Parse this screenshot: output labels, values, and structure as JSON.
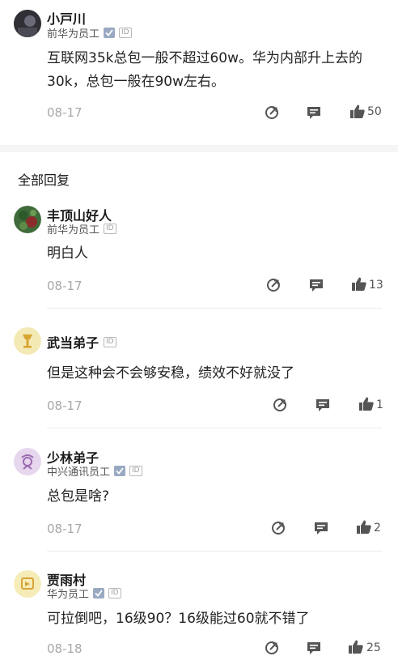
{
  "post": {
    "author": "小戸川",
    "company": "前华为员工",
    "content_line1": "互联网35k总包一般不超过60w。华为内部升上去的",
    "content_line2": "30k，总包一般在90w左右。",
    "date": "08-17",
    "likes": "50"
  },
  "section_title": "全部回复",
  "replies": [
    {
      "name": "丰顶山好人",
      "company": "前华为员工",
      "content": "明白人",
      "date": "08-17",
      "likes": "13"
    },
    {
      "name": "武当弟子",
      "company": "",
      "content": "但是这种会不会够安稳，绩效不好就没了",
      "date": "08-17",
      "likes": "1"
    },
    {
      "name": "少林弟子",
      "company": "中兴通讯员工",
      "content": "总包是啥?",
      "date": "08-17",
      "likes": "2"
    },
    {
      "name": "贾雨村",
      "company": "华为员工",
      "content": "可拉倒吧，16级90？16级能过60就不错了",
      "date": "08-18",
      "likes": "25"
    }
  ],
  "badges": {
    "id_label": "ID"
  },
  "icons": {
    "share": "share-icon",
    "comment": "comment-icon",
    "like": "thumbs-up-icon",
    "verified": "verified-icon"
  },
  "colors": {
    "icon_gray": "#555555",
    "muted_text": "#a7a7a7",
    "divider": "#ececec",
    "section_bg": "#f5f5f5"
  }
}
